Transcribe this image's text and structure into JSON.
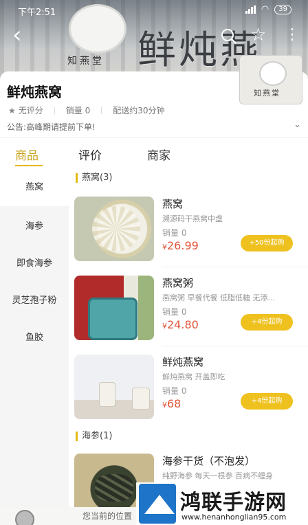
{
  "status_bar": {
    "time": "下午2:51",
    "battery": "39"
  },
  "header": {
    "sign_big": "鲜炖燕",
    "sign_small": "知燕堂"
  },
  "shop": {
    "name": "鲜炖燕窝",
    "rating": "无评分",
    "sales": "销量 0",
    "delivery": "配送约30分钟",
    "notice": "公告:高峰期请提前下单!",
    "logo_text": "知燕堂"
  },
  "tabs": [
    {
      "label": "商品",
      "active": true
    },
    {
      "label": "评价",
      "active": false
    },
    {
      "label": "商家",
      "active": false
    }
  ],
  "categories": [
    "燕窝",
    "海参",
    "即食海参",
    "灵芝孢子粉",
    "鱼胶"
  ],
  "sections": [
    {
      "title": "燕窝(3)",
      "items": [
        {
          "name": "燕窝",
          "desc": "溯源码干燕窝中盏",
          "sales": "销量 0",
          "currency": "¥",
          "price": "26.99",
          "button": "+50份起购"
        },
        {
          "name": "燕窝粥",
          "desc": "燕窝粥 早餐代餐 低脂低糖 无添...",
          "sales": "销量 0",
          "currency": "¥",
          "price": "24.80",
          "button": "+4份起购"
        },
        {
          "name": "鲜炖燕窝",
          "desc": "鲜炖燕窝 开盖即吃",
          "sales": "销量 0",
          "currency": "¥",
          "price": "68",
          "button": "+4份起购"
        }
      ]
    },
    {
      "title": "海参(1)",
      "items": [
        {
          "name": "海参干货（不泡发）",
          "desc": "纯野海参 每天一根参 百病不缠身"
        }
      ]
    }
  ],
  "footer": {
    "location_text": "您当前的位置"
  },
  "watermark": {
    "name": "鸿联手游网",
    "url": "www.henanhonglian95.com"
  },
  "colors": {
    "accent": "#e5b815",
    "price": "#e0553a",
    "button": "#efc11f"
  }
}
